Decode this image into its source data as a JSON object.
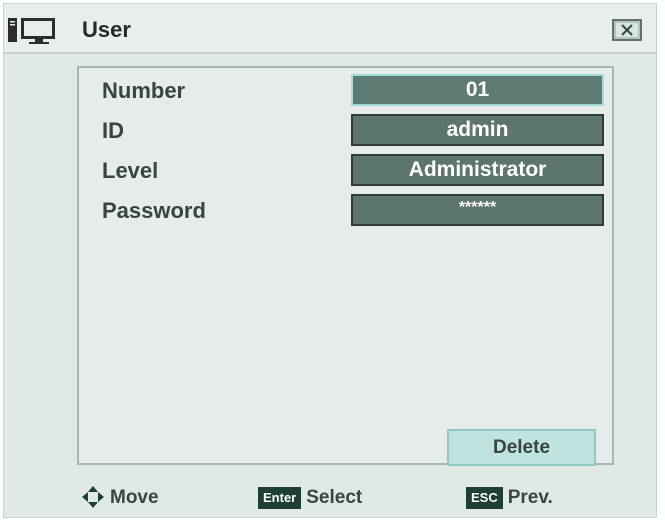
{
  "window": {
    "title": "User",
    "title_icon": "monitor-icon",
    "close_icon": "close-icon"
  },
  "form": {
    "rows": [
      {
        "label": "Number",
        "value": "01"
      },
      {
        "label": "ID",
        "value": "admin"
      },
      {
        "label": "Level",
        "value": "Administrator"
      },
      {
        "label": "Password",
        "value": "******"
      }
    ],
    "delete_label": "Delete"
  },
  "footer": {
    "move_label": "Move",
    "move_icon": "direction-pad-icon",
    "enter_key": "Enter",
    "select_label": "Select",
    "esc_key": "ESC",
    "prev_label": "Prev."
  },
  "colors": {
    "background": "#e1e9e6",
    "field_fill": "#5c766f",
    "field_border": "#2e3d39",
    "selected_border": "#a3dbd8",
    "button_fill": "#bfe3de",
    "key_badge": "#1d3f35"
  }
}
